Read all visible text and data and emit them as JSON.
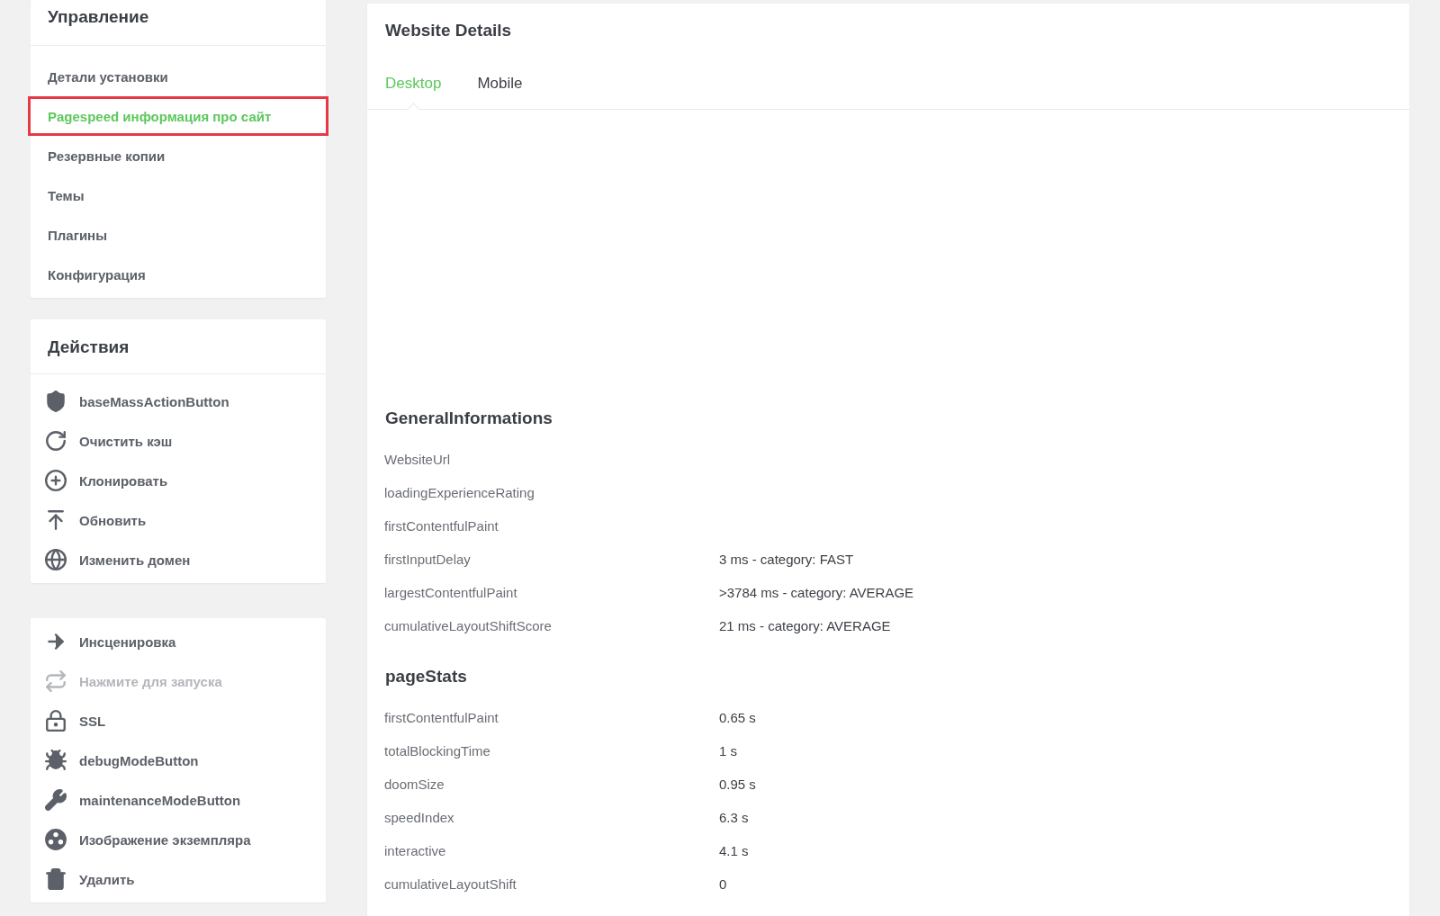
{
  "sidebar": {
    "management": {
      "title": "Управление",
      "items": [
        {
          "label": "Детали установки",
          "selected": false
        },
        {
          "label": "Pagespeed информация про сайт",
          "selected": true
        },
        {
          "label": "Резервные копии",
          "selected": false
        },
        {
          "label": "Темы",
          "selected": false
        },
        {
          "label": "Плагины",
          "selected": false
        },
        {
          "label": "Конфигурация",
          "selected": false
        }
      ]
    },
    "actions": {
      "title": "Действия",
      "items": [
        {
          "label": "baseMassActionButton",
          "disabled": false
        },
        {
          "label": "Очистить кэш",
          "disabled": false
        },
        {
          "label": "Клонировать",
          "disabled": false
        },
        {
          "label": "Обновить",
          "disabled": false
        },
        {
          "label": "Изменить домен",
          "disabled": false
        }
      ]
    },
    "tools": {
      "items": [
        {
          "label": "Инсценировка",
          "disabled": false
        },
        {
          "label": "Нажмите для запуска",
          "disabled": true
        },
        {
          "label": "SSL",
          "disabled": false
        },
        {
          "label": "debugModeButton",
          "disabled": false
        },
        {
          "label": "maintenanceModeButton",
          "disabled": false
        },
        {
          "label": "Изображение экземпляра",
          "disabled": false
        },
        {
          "label": "Удалить",
          "disabled": false
        }
      ]
    }
  },
  "main": {
    "title": "Website Details",
    "tabs": [
      {
        "label": "Desktop",
        "selected": true
      },
      {
        "label": "Mobile",
        "selected": false
      }
    ],
    "sections": [
      {
        "title": "GeneralInformations",
        "rows": [
          {
            "label": "WebsiteUrl"
          },
          {
            "label": "loadingExperienceRating"
          },
          {
            "label": "firstContentfulPaint"
          },
          {
            "label": "firstInputDelay",
            "value": "3 ms - category: FAST"
          },
          {
            "label": "largestContentfulPaint",
            "value": ">3784 ms - category: AVERAGE"
          },
          {
            "label": "cumulativeLayoutShiftScore",
            "value": "21 ms - category: AVERAGE"
          }
        ]
      },
      {
        "title": "pageStats",
        "rows": [
          {
            "label": "firstContentfulPaint",
            "value": "0.65 s"
          },
          {
            "label": "totalBlockingTime",
            "value": "1 s"
          },
          {
            "label": "doomSize",
            "value": "0.95 s"
          },
          {
            "label": "speedIndex",
            "value": "6.3 s"
          },
          {
            "label": "interactive",
            "value": "4.1 s"
          },
          {
            "label": "cumulativeLayoutShift",
            "value": "0"
          }
        ]
      }
    ]
  }
}
